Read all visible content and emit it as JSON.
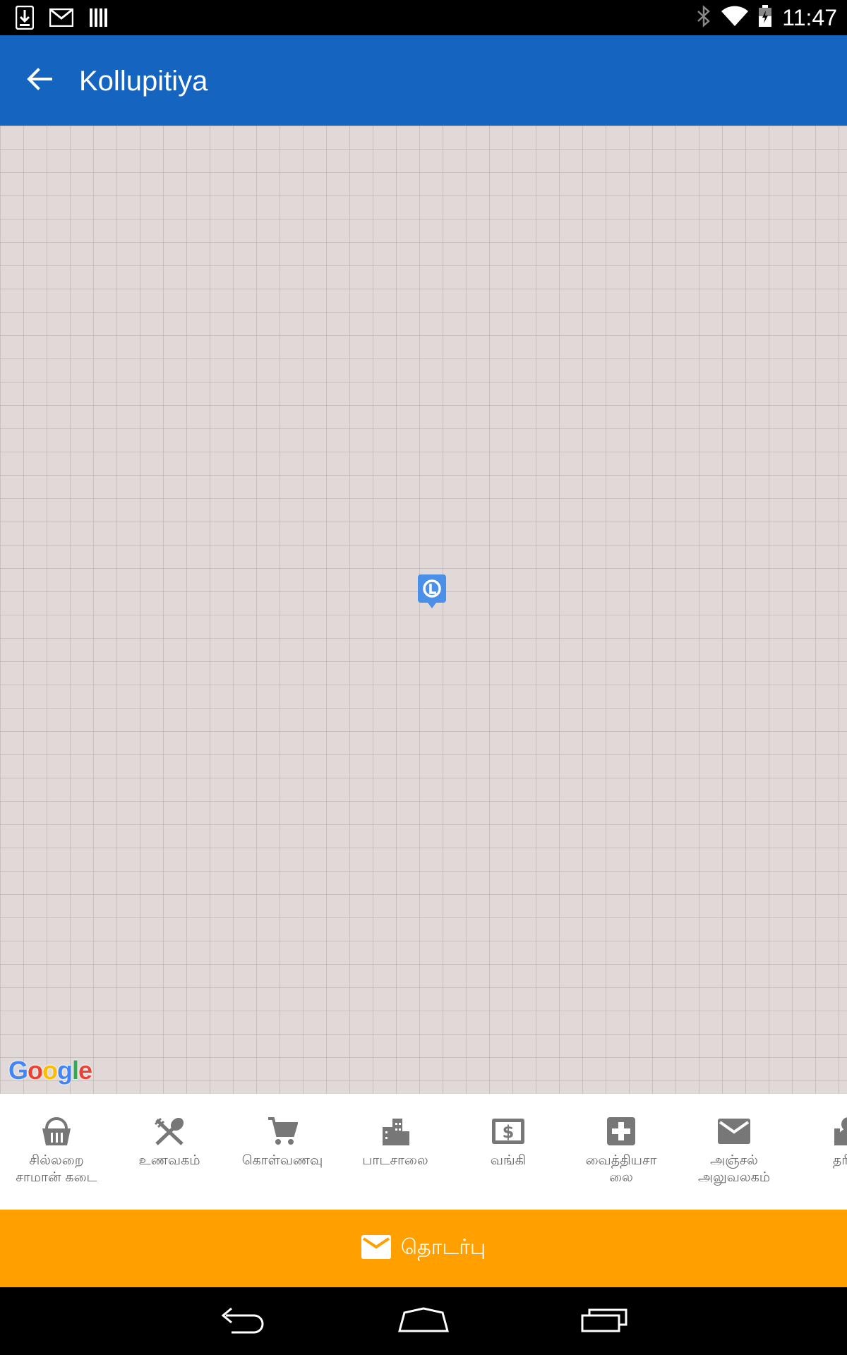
{
  "status_bar": {
    "time": "11:47",
    "left_icons": [
      "download-icon",
      "gmail-icon",
      "barcode-icon"
    ],
    "right_icons": [
      "bluetooth-icon",
      "wifi-icon",
      "battery-icon"
    ]
  },
  "app_bar": {
    "title": "Kollupitiya",
    "back_icon": "arrow-back-icon"
  },
  "map": {
    "marker_icon": "location-marker-icon",
    "attribution": {
      "letters": [
        "G",
        "o",
        "o",
        "g",
        "l",
        "e"
      ],
      "colors": [
        "#4285F4",
        "#EA4335",
        "#FBBC05",
        "#4285F4",
        "#34A853",
        "#EA4335"
      ]
    }
  },
  "categories": [
    {
      "label": "சில்லறை\nசாமான் கடை",
      "icon": "basket-icon"
    },
    {
      "label": "உணவகம்",
      "icon": "restaurant-icon"
    },
    {
      "label": "கொள்வணவு",
      "icon": "cart-icon"
    },
    {
      "label": "பாடசாலை",
      "icon": "building-icon"
    },
    {
      "label": "வங்கி",
      "icon": "money-icon"
    },
    {
      "label": "வைத்தியசா\nலை",
      "icon": "hospital-icon"
    },
    {
      "label": "அஞ்சல்\nஅலுவலகம்",
      "icon": "mail-icon"
    },
    {
      "label": "தரிப்",
      "icon": "person-icon"
    }
  ],
  "contact": {
    "label": "தொடர்பு",
    "icon": "mail-icon"
  },
  "nav_bar": {
    "buttons": [
      "back-nav-icon",
      "home-nav-icon",
      "recents-nav-icon"
    ]
  },
  "colors": {
    "app_bar": "#1565C0",
    "contact_bar": "#FFA000",
    "map_bg": "#e0d9d8",
    "icon_gray": "#757575"
  }
}
